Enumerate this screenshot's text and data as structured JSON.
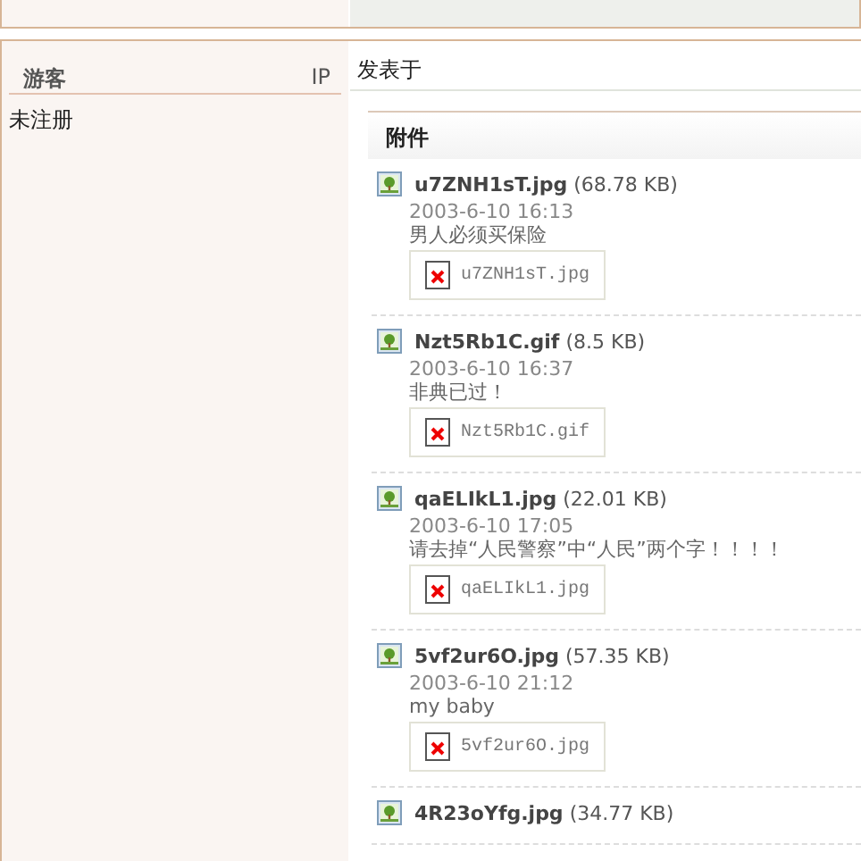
{
  "author": {
    "name": "游客",
    "ip_label": "IP",
    "status": "未注册"
  },
  "post": {
    "posted_label": "发表于"
  },
  "attachments": {
    "title": "附件",
    "items": [
      {
        "filename": "u7ZNH1sT.jpg",
        "size": "(68.78 KB)",
        "date": "2003-6-10 16:13",
        "description": "男人必须买保险",
        "thumbnail": "u7ZNH1sT.jpg"
      },
      {
        "filename": "Nzt5Rb1C.gif",
        "size": "(8.5 KB)",
        "date": "2003-6-10 16:37",
        "description": "非典已过！",
        "thumbnail": "Nzt5Rb1C.gif"
      },
      {
        "filename": "qaELIkL1.jpg",
        "size": "(22.01 KB)",
        "date": "2003-6-10 17:05",
        "description": "请去掉“人民警察”中“人民”两个字！！！！",
        "thumbnail": "qaELIkL1.jpg"
      },
      {
        "filename": "5vf2ur6O.jpg",
        "size": "(57.35 KB)",
        "date": "2003-6-10 21:12",
        "description": "my baby",
        "thumbnail": "5vf2ur6O.jpg"
      },
      {
        "filename": "4R23oYfg.jpg",
        "size": "(34.77 KB)"
      }
    ]
  }
}
